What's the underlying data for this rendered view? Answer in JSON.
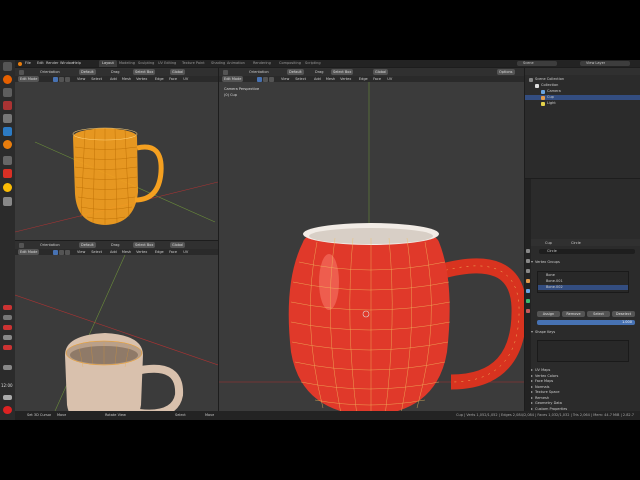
{
  "colors": {
    "accent": "#4772b3",
    "selection_orange": "#f5a020",
    "mug_red": "#e0392a",
    "viewport_bg": "#3b3b3b",
    "panel_bg": "#2b2b2b"
  },
  "topbar": {
    "menu": [
      "File",
      "Edit",
      "Render",
      "Window",
      "Help"
    ],
    "workspaces": [
      "Layout",
      "Modeling",
      "Sculpting",
      "UV Editing",
      "Texture Paint",
      "Shading",
      "Animation",
      "Rendering",
      "Compositing",
      "Scripting"
    ],
    "active_workspace": "Layout",
    "scene_label": "Scene",
    "view_layer_label": "View Layer"
  },
  "viewport_top_left": {
    "orientation": "Orientation",
    "default": "Default",
    "drag": "Drag",
    "select_box": "Select Box",
    "transform": "Global",
    "mode": "Edit Mode",
    "menus": [
      "View",
      "Select",
      "Add",
      "Mesh",
      "Vertex",
      "Edge",
      "Face",
      "UV"
    ]
  },
  "viewport_bottom_left": {
    "orientation": "Orientation",
    "default": "Default",
    "drag": "Drag",
    "select_box": "Select Box",
    "transform": "Global",
    "mode": "Edit Mode",
    "menus": [
      "View",
      "Select",
      "Add",
      "Mesh",
      "Vertex",
      "Edge",
      "Face",
      "UV"
    ]
  },
  "viewport_main": {
    "orientation": "Orientation",
    "default": "Default",
    "drag": "Drag",
    "select_box": "Select Box",
    "transform": "Global",
    "options": "Options",
    "mode": "Edit Mode",
    "menus": [
      "View",
      "Select",
      "Add",
      "Mesh",
      "Vertex",
      "Edge",
      "Face",
      "UV"
    ],
    "overlay_line1": "Camera Perspective",
    "overlay_line2": "(0) Cup"
  },
  "outliner": {
    "items": [
      {
        "label": "Scene Collection",
        "indent": 0
      },
      {
        "label": "Collection",
        "indent": 1
      },
      {
        "label": "Camera",
        "indent": 2
      },
      {
        "label": "Cup",
        "indent": 2
      },
      {
        "label": "Light",
        "indent": 2
      }
    ]
  },
  "properties": {
    "tab_object": "Cup",
    "tab_mesh": "Circle",
    "mesh_name": "Circle",
    "vertex_groups_label": "Vertex Groups",
    "vertex_groups": [
      "Bone",
      "Bone.001",
      "Bone.002"
    ],
    "selected_group": "Bone.002",
    "buttons": [
      "Assign",
      "Remove",
      "Select",
      "Deselect"
    ],
    "weight_value": "1.000",
    "shape_keys_label": "Shape Keys",
    "sections": [
      "UV Maps",
      "Vertex Colors",
      "Face Maps",
      "Normals",
      "Texture Space",
      "Remesh",
      "Geometry Data",
      "Custom Properties"
    ]
  },
  "dock": {
    "clock": "12:00"
  },
  "statusbar": {
    "left_items": [
      "Set 3D Cursor",
      "Move",
      "Rotate View",
      "Select",
      "Move"
    ],
    "stats": "Cup | Verts 1,052/1,052 | Edges 2,084/2,084 | Faces 1,032/1,032 | Tris 2,064 | Mem: 44.7 MiB | 2.82.7"
  }
}
